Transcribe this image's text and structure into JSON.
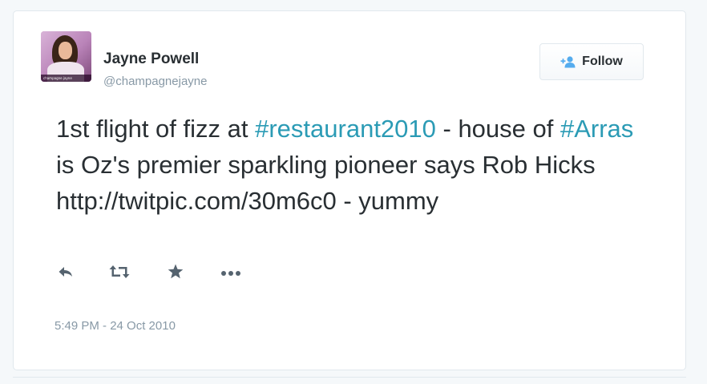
{
  "user": {
    "name": "Jayne Powell",
    "handle": "@champagnejayne",
    "avatar_caption": "champagne jayne"
  },
  "follow_button": {
    "label": "Follow",
    "icon": "add-user-icon"
  },
  "tweet": {
    "segments": [
      {
        "text": "1st flight of fizz at ",
        "type": "text"
      },
      {
        "text": "#restaurant2010",
        "type": "hashtag"
      },
      {
        "text": " - house of ",
        "type": "text"
      },
      {
        "text": "#Arras",
        "type": "hashtag"
      },
      {
        "text": " is Oz's premier sparkling pioneer says Rob Hicks  http://twitpic.com/30m6c0 - yummy",
        "type": "text"
      }
    ],
    "timestamp": "5:49 PM - 24 Oct 2010"
  },
  "actions": [
    {
      "name": "reply",
      "icon": "reply-icon"
    },
    {
      "name": "retweet",
      "icon": "retweet-icon"
    },
    {
      "name": "favorite",
      "icon": "star-icon"
    },
    {
      "name": "more",
      "icon": "more-icon"
    }
  ],
  "colors": {
    "text": "#292f33",
    "muted": "#8899a6",
    "hashtag": "#2b9bb5",
    "follow_icon": "#55acee",
    "action_icon": "#55636f"
  }
}
